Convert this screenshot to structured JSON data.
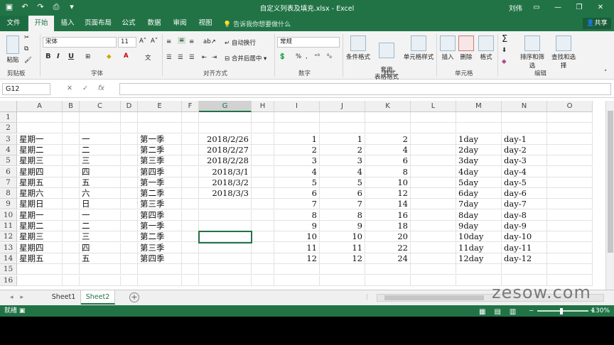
{
  "window": {
    "title": "自定义列表及填充.xlsx  -  Excel",
    "user": "刘伟",
    "share_label": "共享"
  },
  "tabs": [
    "文件",
    "开始",
    "插入",
    "页面布局",
    "公式",
    "数据",
    "审阅",
    "视图"
  ],
  "tell_me": "告诉我你想要做什么",
  "ribbon": {
    "clipboard": {
      "paste": "粘贴",
      "label": "剪贴板"
    },
    "font": {
      "name": "宋体",
      "size": "11",
      "bold": "B",
      "italic": "I",
      "underline": "U",
      "label": "字体"
    },
    "alignment": {
      "wrap": "自动换行",
      "merge": "合并后居中",
      "label": "对齐方式"
    },
    "number": {
      "format": "常规",
      "label": "数字"
    },
    "styles": {
      "conditional": "条件格式",
      "table": "套用\n表格格式",
      "cell_styles": "单元格样式",
      "label": "样式"
    },
    "cells": {
      "insert": "插入",
      "delete": "删除",
      "format": "格式",
      "label": "单元格"
    },
    "editing": {
      "sort": "排序和筛选",
      "find": "查找和选择",
      "label": "编辑"
    }
  },
  "formula_bar": {
    "name_box": "G12",
    "fx": "fx",
    "formula": ""
  },
  "columns": [
    "A",
    "B",
    "C",
    "D",
    "E",
    "F",
    "G",
    "H",
    "I",
    "J",
    "K",
    "L",
    "M",
    "N",
    "O"
  ],
  "selected_column": "G",
  "selected_cell": "G12",
  "rows": [
    {
      "n": "1"
    },
    {
      "n": "2"
    },
    {
      "n": "3",
      "A": "星期一",
      "C": "一",
      "E": "第一季",
      "G": "2018/2/26",
      "I": "1",
      "J": "1",
      "K": "2",
      "M": "1day",
      "N": "day-1"
    },
    {
      "n": "4",
      "A": "星期二",
      "C": "二",
      "E": "第二季",
      "G": "2018/2/27",
      "I": "2",
      "J": "2",
      "K": "4",
      "M": "2day",
      "N": "day-2"
    },
    {
      "n": "5",
      "A": "星期三",
      "C": "三",
      "E": "第三季",
      "G": "2018/2/28",
      "I": "3",
      "J": "3",
      "K": "6",
      "M": "3day",
      "N": "day-3"
    },
    {
      "n": "6",
      "A": "星期四",
      "C": "四",
      "E": "第四季",
      "G": "2018/3/1",
      "I": "4",
      "J": "4",
      "K": "8",
      "M": "4day",
      "N": "day-4"
    },
    {
      "n": "7",
      "A": "星期五",
      "C": "五",
      "E": "第一季",
      "G": "2018/3/2",
      "I": "5",
      "J": "5",
      "K": "10",
      "M": "5day",
      "N": "day-5"
    },
    {
      "n": "8",
      "A": "星期六",
      "C": "六",
      "E": "第二季",
      "G": "2018/3/3",
      "I": "6",
      "J": "6",
      "K": "12",
      "M": "6day",
      "N": "day-6"
    },
    {
      "n": "9",
      "A": "星期日",
      "C": "日",
      "E": "第三季",
      "I": "7",
      "J": "7",
      "K": "14",
      "M": "7day",
      "N": "day-7"
    },
    {
      "n": "10",
      "A": "星期一",
      "C": "一",
      "E": "第四季",
      "I": "8",
      "J": "8",
      "K": "16",
      "M": "8day",
      "N": "day-8"
    },
    {
      "n": "11",
      "A": "星期二",
      "C": "二",
      "E": "第一季",
      "I": "9",
      "J": "9",
      "K": "18",
      "M": "9day",
      "N": "day-9"
    },
    {
      "n": "12",
      "A": "星期三",
      "C": "三",
      "E": "第二季",
      "I": "10",
      "J": "10",
      "K": "20",
      "M": "10day",
      "N": "day-10"
    },
    {
      "n": "13",
      "A": "星期四",
      "C": "四",
      "E": "第三季",
      "I": "11",
      "J": "11",
      "K": "22",
      "M": "11day",
      "N": "day-11"
    },
    {
      "n": "14",
      "A": "星期五",
      "C": "五",
      "E": "第四季",
      "I": "12",
      "J": "12",
      "K": "24",
      "M": "12day",
      "N": "day-12"
    },
    {
      "n": "15"
    },
    {
      "n": "16"
    }
  ],
  "sheets": [
    "Sheet1",
    "Sheet2"
  ],
  "active_sheet": "Sheet2",
  "status": {
    "ready": "就绪",
    "zoom": "130%"
  },
  "watermark": "zesow.com",
  "colors": {
    "accent": "#217346",
    "selection": "#217346"
  }
}
